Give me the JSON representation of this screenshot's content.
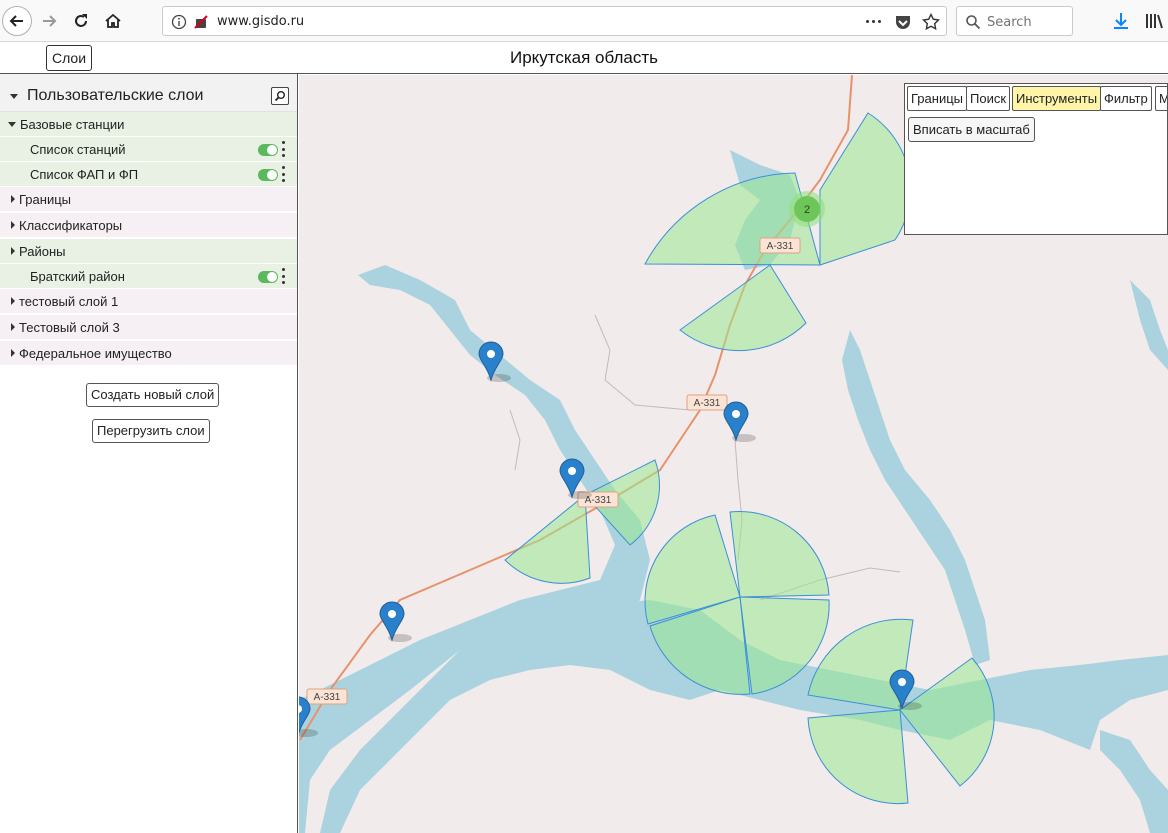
{
  "browser": {
    "url": "www.gisdo.ru",
    "search_placeholder": "Search",
    "icons": [
      "back-icon",
      "forward-icon",
      "reload-icon",
      "home-icon",
      "info-icon",
      "tracking-blocked-icon",
      "page-actions-icon",
      "pocket-icon",
      "bookmark-star-icon",
      "search-icon",
      "download-icon",
      "library-icon"
    ]
  },
  "header": {
    "layers_button": "Слои",
    "title": "Иркутская область"
  },
  "panel": {
    "title": "Пользовательские слои",
    "items": [
      {
        "label": "Базовые станции",
        "expanded": true,
        "level": 0
      },
      {
        "label": "Список станций",
        "level": 1,
        "toggle": true
      },
      {
        "label": "Список ФАП и ФП",
        "level": 1,
        "toggle": true
      },
      {
        "label": "Границы",
        "level": 0
      },
      {
        "label": "Классификаторы",
        "level": 0
      },
      {
        "label": "Районы",
        "level": 0
      },
      {
        "label": "Братский район",
        "level": 1,
        "toggle": true
      },
      {
        "label": "тестовый слой 1",
        "level": 0
      },
      {
        "label": "Тестовый слой 3",
        "level": 0
      },
      {
        "label": "Федеральное имущество",
        "level": 0
      }
    ],
    "create_button": "Создать новый слой",
    "reload_button": "Перегрузить слои"
  },
  "toolbox": {
    "tabs": [
      "Границы",
      "Поиск",
      "Инструменты",
      "Фильтр",
      "М"
    ],
    "active_tab": "Инструменты",
    "fit_button": "Вписать в масштаб"
  },
  "map": {
    "road_label": "А-331",
    "cluster_count": "2",
    "colors": {
      "background": "#f2ebec",
      "water": "#aad3df",
      "sector_fill": "#9be88f",
      "sector_stroke": "#3a8fd8",
      "road": "#e8926b",
      "marker": "#2a81cb"
    }
  }
}
